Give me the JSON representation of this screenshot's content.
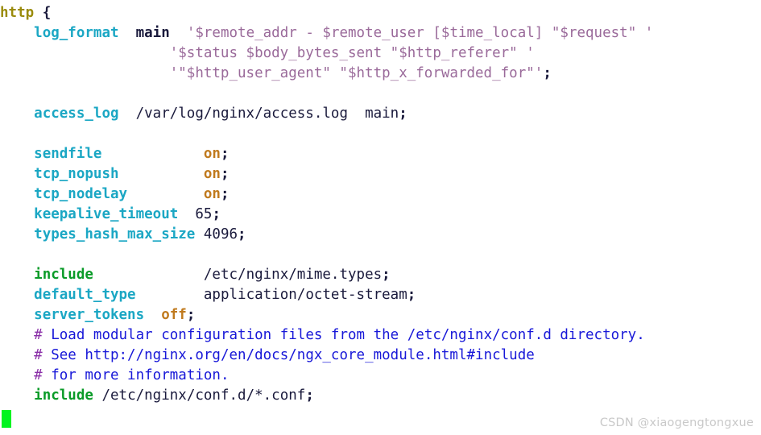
{
  "app": {
    "kind": "terminal-text-editor",
    "filename_context": "nginx.conf",
    "background": "#ffffff"
  },
  "colors": {
    "block_keyword": "#9a8b0b",
    "directive_cyan": "#1ba7c4",
    "directive_green": "#0a9b28",
    "string_purple": "#9a6a9a",
    "path_navy": "#1a1a3c",
    "boolean_orange": "#c07a1e",
    "comment_blue": "#1818d8",
    "comment_hash_purple": "#8a2fa8",
    "cursor_green": "#00f420",
    "watermark_gray": "#c9c9c9"
  },
  "cursor": {
    "visible": true,
    "shape": "block",
    "line": 17,
    "column": 0
  },
  "watermark": {
    "text": "CSDN @xiaogengtongxue"
  },
  "lines": [
    {
      "index": 0,
      "tokens": [
        {
          "text": "http",
          "type": "block"
        },
        {
          "text": " ",
          "type": "plain"
        },
        {
          "text": "{",
          "type": "brace"
        }
      ]
    },
    {
      "index": 1,
      "tokens": [
        {
          "text": "    ",
          "type": "plain"
        },
        {
          "text": "log_format",
          "type": "dir"
        },
        {
          "text": "  ",
          "type": "plain"
        },
        {
          "text": "main",
          "type": "ident"
        },
        {
          "text": "  ",
          "type": "plain"
        },
        {
          "text": "'$remote_addr - $remote_user [$time_local] \"$request\" '",
          "type": "str"
        }
      ]
    },
    {
      "index": 2,
      "tokens": [
        {
          "text": "                    ",
          "type": "plain"
        },
        {
          "text": "'$status $body_bytes_sent \"$http_referer\" '",
          "type": "str"
        }
      ]
    },
    {
      "index": 3,
      "tokens": [
        {
          "text": "                    ",
          "type": "plain"
        },
        {
          "text": "'\"$http_user_agent\" \"$http_x_forwarded_for\"'",
          "type": "str"
        },
        {
          "text": ";",
          "type": "punc"
        }
      ]
    },
    {
      "index": 4,
      "tokens": []
    },
    {
      "index": 5,
      "tokens": [
        {
          "text": "    ",
          "type": "plain"
        },
        {
          "text": "access_log",
          "type": "dir"
        },
        {
          "text": "  ",
          "type": "plain"
        },
        {
          "text": "/var/log/nginx/access.log",
          "type": "path"
        },
        {
          "text": "  ",
          "type": "plain"
        },
        {
          "text": "main",
          "type": "path"
        },
        {
          "text": ";",
          "type": "punc"
        }
      ]
    },
    {
      "index": 6,
      "tokens": []
    },
    {
      "index": 7,
      "tokens": [
        {
          "text": "    ",
          "type": "plain"
        },
        {
          "text": "sendfile",
          "type": "dir"
        },
        {
          "text": "            ",
          "type": "plain"
        },
        {
          "text": "on",
          "type": "bool"
        },
        {
          "text": ";",
          "type": "punc"
        }
      ]
    },
    {
      "index": 8,
      "tokens": [
        {
          "text": "    ",
          "type": "plain"
        },
        {
          "text": "tcp_nopush",
          "type": "dir"
        },
        {
          "text": "          ",
          "type": "plain"
        },
        {
          "text": "on",
          "type": "bool"
        },
        {
          "text": ";",
          "type": "punc"
        }
      ]
    },
    {
      "index": 9,
      "tokens": [
        {
          "text": "    ",
          "type": "plain"
        },
        {
          "text": "tcp_nodelay",
          "type": "dir"
        },
        {
          "text": "         ",
          "type": "plain"
        },
        {
          "text": "on",
          "type": "bool"
        },
        {
          "text": ";",
          "type": "punc"
        }
      ]
    },
    {
      "index": 10,
      "tokens": [
        {
          "text": "    ",
          "type": "plain"
        },
        {
          "text": "keepalive_timeout",
          "type": "dir"
        },
        {
          "text": "  ",
          "type": "plain"
        },
        {
          "text": "65",
          "type": "num"
        },
        {
          "text": ";",
          "type": "punc"
        }
      ]
    },
    {
      "index": 11,
      "tokens": [
        {
          "text": "    ",
          "type": "plain"
        },
        {
          "text": "types_hash_max_size",
          "type": "dir"
        },
        {
          "text": " ",
          "type": "plain"
        },
        {
          "text": "4096",
          "type": "num"
        },
        {
          "text": ";",
          "type": "punc"
        }
      ]
    },
    {
      "index": 12,
      "tokens": []
    },
    {
      "index": 13,
      "tokens": [
        {
          "text": "    ",
          "type": "plain"
        },
        {
          "text": "include",
          "type": "dir-grn"
        },
        {
          "text": "             ",
          "type": "plain"
        },
        {
          "text": "/etc/nginx/mime.types",
          "type": "path"
        },
        {
          "text": ";",
          "type": "punc"
        }
      ]
    },
    {
      "index": 14,
      "tokens": [
        {
          "text": "    ",
          "type": "plain"
        },
        {
          "text": "default_type",
          "type": "dir"
        },
        {
          "text": "        ",
          "type": "plain"
        },
        {
          "text": "application/octet-stream",
          "type": "path"
        },
        {
          "text": ";",
          "type": "punc"
        }
      ]
    },
    {
      "index": 15,
      "tokens": [
        {
          "text": "    ",
          "type": "plain"
        },
        {
          "text": "server_tokens",
          "type": "dir"
        },
        {
          "text": "  ",
          "type": "plain"
        },
        {
          "text": "off",
          "type": "bool"
        },
        {
          "text": ";",
          "type": "punc"
        }
      ]
    },
    {
      "index": 16,
      "tokens": [
        {
          "text": "    ",
          "type": "plain"
        },
        {
          "text": "#",
          "type": "hash"
        },
        {
          "text": " Load modular configuration files from the /etc/nginx/conf.d directory.",
          "type": "comment"
        }
      ]
    },
    {
      "index": 17,
      "tokens": [
        {
          "text": "    ",
          "type": "plain"
        },
        {
          "text": "#",
          "type": "hash"
        },
        {
          "text": " See http://nginx.org/en/docs/ngx_core_module.html#include",
          "type": "comment"
        }
      ]
    },
    {
      "index": 18,
      "tokens": [
        {
          "text": "    ",
          "type": "plain"
        },
        {
          "text": "#",
          "type": "hash"
        },
        {
          "text": " for more information.",
          "type": "comment"
        }
      ]
    },
    {
      "index": 19,
      "tokens": [
        {
          "text": "    ",
          "type": "plain"
        },
        {
          "text": "include",
          "type": "dir-grn"
        },
        {
          "text": " ",
          "type": "plain"
        },
        {
          "text": "/etc/nginx/conf.d/*.conf",
          "type": "path"
        },
        {
          "text": ";",
          "type": "punc"
        }
      ]
    },
    {
      "index": 20,
      "tokens": []
    }
  ]
}
